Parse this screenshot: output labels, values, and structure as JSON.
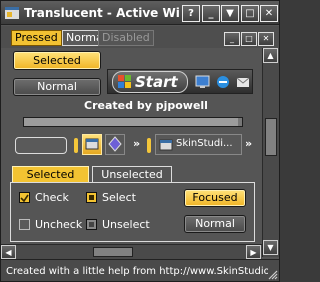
{
  "window": {
    "title": "Translucent - Active Wind..."
  },
  "caption_buttons": [
    "?",
    "_",
    "▼",
    "□",
    "✕"
  ],
  "menu": {
    "pressed_label": "Pressed",
    "normal_label": "Normal",
    "disabled_label": "Disabled"
  },
  "buttons": {
    "selected_label": "Selected",
    "normal_label": "Normal"
  },
  "taskbar": {
    "start_label": "Start"
  },
  "credit": "Created by pjpowell",
  "progress": {
    "value_fraction": 0.98
  },
  "toolbar": {
    "chevron": "»",
    "skinstudio_label": "SkinStudi...",
    "more_label": "»"
  },
  "tabs": {
    "selected_label": "Selected",
    "unselected_label": "Unselected"
  },
  "options": {
    "check_label": "Check",
    "uncheck_label": "Uncheck",
    "select_label": "Select",
    "unselect_label": "Unselect",
    "focused_label": "Focused",
    "normal_label": "Normal"
  },
  "status": {
    "text": "Created with a little help from http://www.SkinStudio.net"
  },
  "colors": {
    "accent": "#f3c332",
    "chrome": "#555555",
    "text": "#ffffff"
  }
}
